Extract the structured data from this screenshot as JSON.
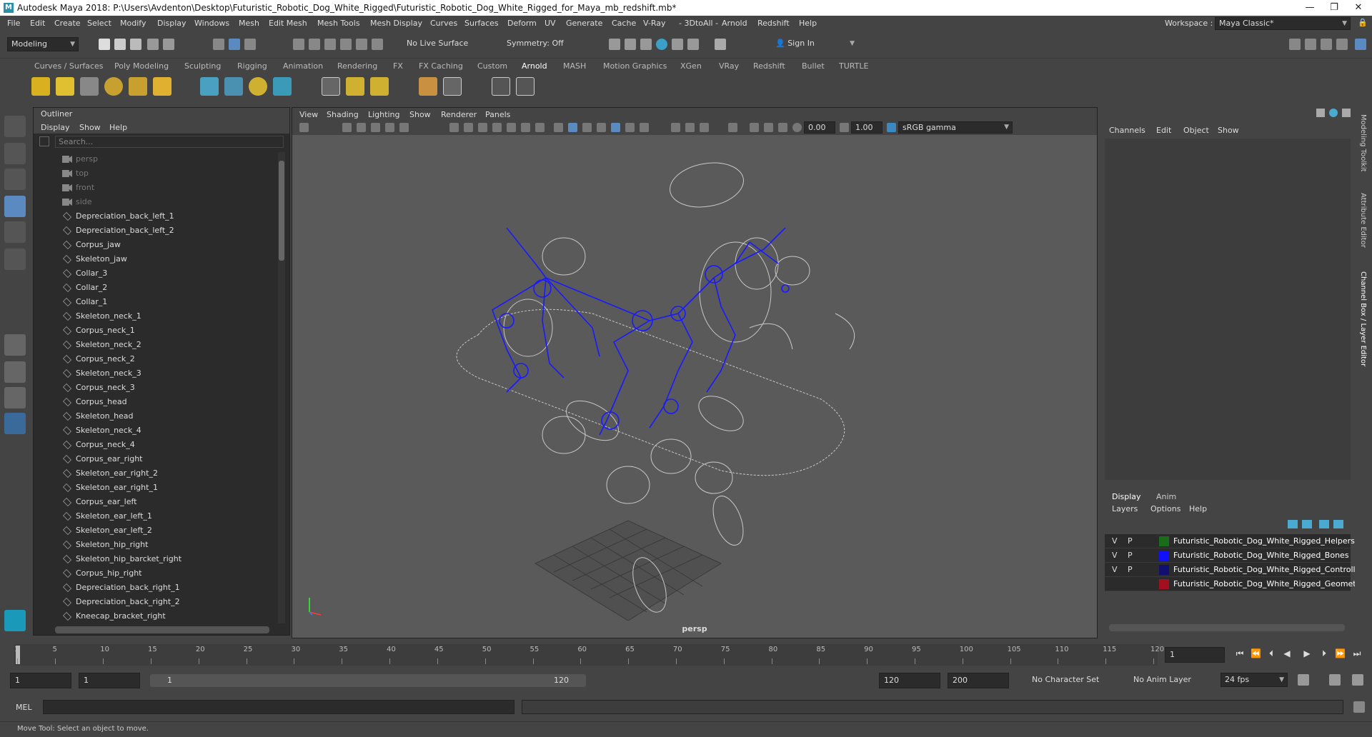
{
  "title": "Autodesk Maya 2018: P:\\Users\\Avdenton\\Desktop\\Futuristic_Robotic_Dog_White_Rigged\\Futuristic_Robotic_Dog_White_Rigged_for_Maya_mb_redshift.mb*",
  "menus": [
    "File",
    "Edit",
    "Create",
    "Select",
    "Modify",
    "Display",
    "Windows",
    "Mesh",
    "Edit Mesh",
    "Mesh Tools",
    "Mesh Display",
    "Curves",
    "Surfaces",
    "Deform",
    "UV",
    "Generate",
    "Cache",
    "V-Ray",
    "3DtoAll",
    "Arnold",
    "Redshift",
    "Help"
  ],
  "workspace": {
    "label": "Workspace :",
    "value": "Maya Classic*"
  },
  "status": {
    "mode": "Modeling",
    "live_surface": "No Live Surface",
    "symmetry": "Symmetry: Off",
    "sign_in": "Sign In"
  },
  "shelf_tabs": [
    "Curves / Surfaces",
    "Poly Modeling",
    "Sculpting",
    "Rigging",
    "Animation",
    "Rendering",
    "FX",
    "FX Caching",
    "Custom",
    "Arnold",
    "MASH",
    "Motion Graphics",
    "XGen",
    "VRay",
    "Redshift",
    "Bullet",
    "TURTLE"
  ],
  "active_shelf": "Arnold",
  "outliner": {
    "title": "Outliner",
    "menu": [
      "Display",
      "Show",
      "Help"
    ],
    "search_placeholder": "Search...",
    "cameras": [
      "persp",
      "top",
      "front",
      "side"
    ],
    "items": [
      "Depreciation_back_left_1",
      "Depreciation_back_left_2",
      "Corpus_jaw",
      "Skeleton_jaw",
      "Collar_3",
      "Collar_2",
      "Collar_1",
      "Skeleton_neck_1",
      "Corpus_neck_1",
      "Skeleton_neck_2",
      "Corpus_neck_2",
      "Skeleton_neck_3",
      "Corpus_neck_3",
      "Corpus_head",
      "Skeleton_head",
      "Skeleton_neck_4",
      "Corpus_neck_4",
      "Corpus_ear_right",
      "Skeleton_ear_right_2",
      "Skeleton_ear_right_1",
      "Corpus_ear_left",
      "Skeleton_ear_left_1",
      "Skeleton_ear_left_2",
      "Skeleton_hip_right",
      "Skeleton_hip_barcket_right",
      "Corpus_hip_right",
      "Depreciation_back_right_1",
      "Depreciation_back_right_2",
      "Kneecap_bracket_right"
    ]
  },
  "viewport": {
    "menu": [
      "View",
      "Shading",
      "Lighting",
      "Show",
      "Renderer",
      "Panels"
    ],
    "exposure": "0.00",
    "gamma": "1.00",
    "color_space": "sRGB gamma",
    "camera": "persp"
  },
  "channel_box": {
    "menu": [
      "Channels",
      "Edit",
      "Object",
      "Show"
    ]
  },
  "layers": {
    "tabs": [
      "Display",
      "Anim"
    ],
    "menu": [
      "Layers",
      "Options",
      "Help"
    ],
    "rows": [
      {
        "v": "V",
        "p": "P",
        "color": "#1a6b1a",
        "name": "Futuristic_Robotic_Dog_White_Rigged_Helpers"
      },
      {
        "v": "V",
        "p": "P",
        "color": "#1010ff",
        "name": "Futuristic_Robotic_Dog_White_Rigged_Bones"
      },
      {
        "v": "V",
        "p": "P",
        "color": "#101070",
        "name": "Futuristic_Robotic_Dog_White_Rigged_Controllers"
      },
      {
        "v": "",
        "p": "",
        "color": "#a01020",
        "name": "Futuristic_Robotic_Dog_White_Rigged_Geometry"
      }
    ]
  },
  "side_tabs": [
    "Modeling Toolkit",
    "Attribute Editor",
    "Channel Box / Layer Editor"
  ],
  "timeline": {
    "ticks": [
      "1",
      "5",
      "10",
      "15",
      "20",
      "25",
      "30",
      "35",
      "40",
      "45",
      "50",
      "55",
      "60",
      "65",
      "70",
      "75",
      "80",
      "85",
      "90",
      "95",
      "100",
      "105",
      "110",
      "115",
      "120"
    ],
    "current": "1"
  },
  "range": {
    "start": "1",
    "start2": "1",
    "slider_start": "1",
    "slider_end": "120",
    "end": "120",
    "end2": "200",
    "character": "No Character Set",
    "anim_layer": "No Anim Layer",
    "fps": "24 fps"
  },
  "cmd": {
    "lang": "MEL"
  },
  "help_text": "Move Tool: Select an object to move."
}
